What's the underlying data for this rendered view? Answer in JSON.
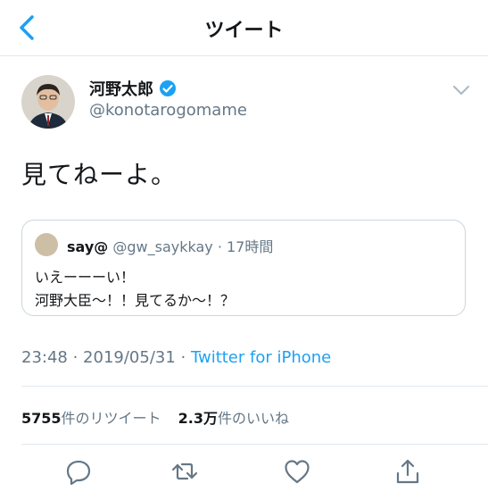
{
  "nav": {
    "title": "ツイート",
    "back_icon": "chevron-left-icon"
  },
  "tweet": {
    "author_name": "河野太郎",
    "author_handle": "@konotarogomame",
    "text": "見てねーよ。",
    "timestamp": "23:48 · 2019/05/31 · ",
    "source": "Twitter for iPhone"
  },
  "quoted": {
    "name": "say@",
    "meta": "@gw_saykkay · 17時間",
    "line1": "いえーーーい！",
    "line2": "河野大臣〜！！見てるか〜！？"
  },
  "stats": {
    "retweets_count": "5755",
    "retweets_label": "件のリツイート",
    "likes_count": "2.3万",
    "likes_label": "件のいいね"
  },
  "actions": [
    "reply-icon",
    "retweet-icon",
    "like-icon",
    "share-icon"
  ],
  "colors": {
    "accent": "#1da1f2",
    "muted": "#657786",
    "text": "#14171a",
    "divider": "#e1e8ed"
  }
}
